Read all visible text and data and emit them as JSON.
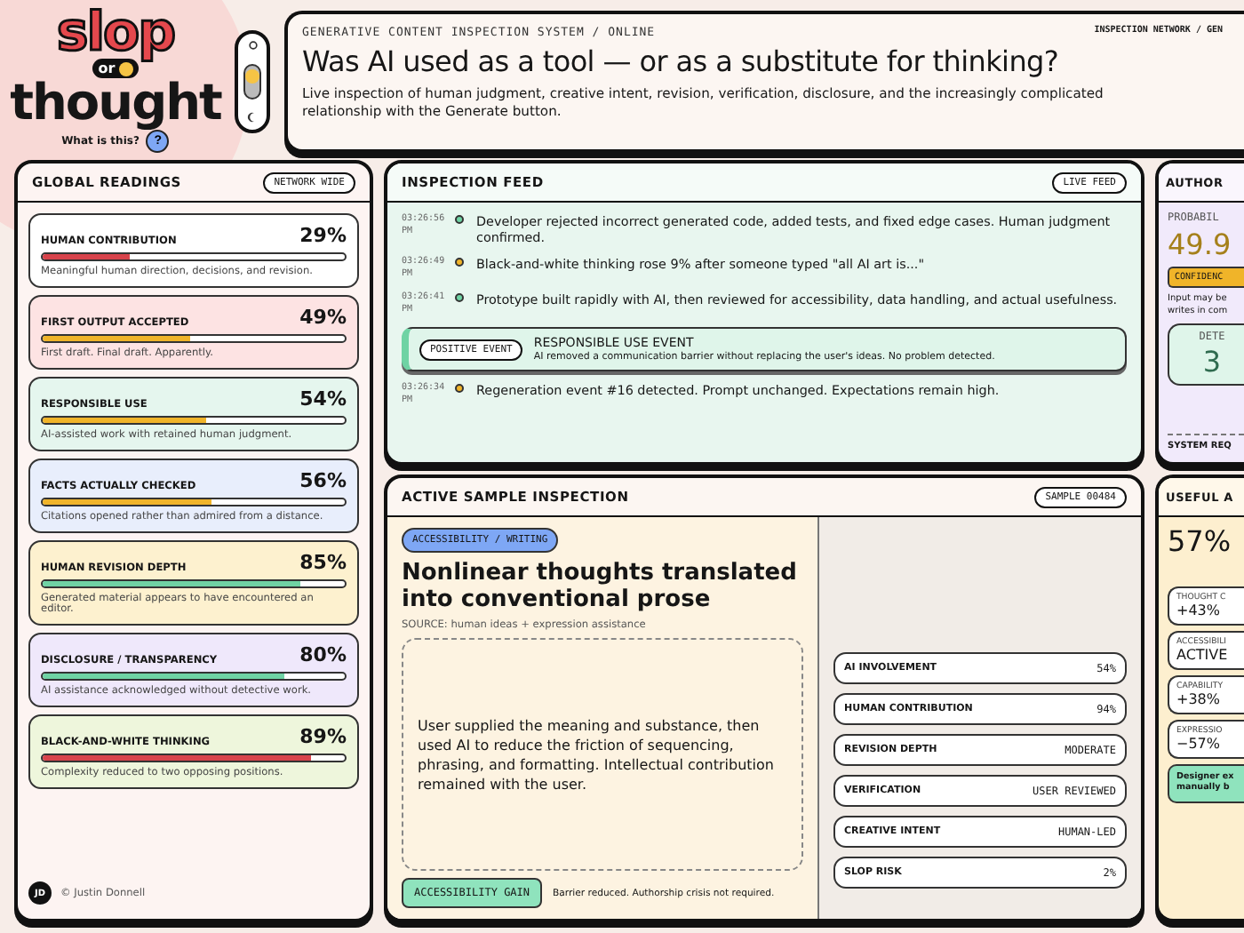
{
  "logo": {
    "word_top": "slop",
    "word_mid": "or",
    "word_bottom": "thought",
    "help_label": "What is this?",
    "help_button": "?"
  },
  "header": {
    "kicker": "GENERATIVE CONTENT INSPECTION SYSTEM / ONLINE",
    "network": "INSPECTION NETWORK / GEN",
    "title": "Was AI used as a tool — or as a substitute for thinking?",
    "subtitle": "Live inspection of human judgment, creative intent, revision, verification, disclosure, and the increasingly complicated relationship with the Generate button."
  },
  "global_readings": {
    "title": "GLOBAL READINGS",
    "badge": "NETWORK WIDE",
    "metrics": [
      {
        "name": "HUMAN CONTRIBUTION",
        "value": "29%",
        "level": 0.29,
        "color": "#d8434b",
        "description": "Meaningful human direction, decisions, and revision."
      },
      {
        "name": "FIRST OUTPUT ACCEPTED",
        "value": "49%",
        "level": 0.49,
        "color": "#f0b429",
        "description": "First draft. Final draft. Apparently."
      },
      {
        "name": "RESPONSIBLE USE",
        "value": "54%",
        "level": 0.54,
        "color": "#f0b429",
        "description": "AI-assisted work with retained human judgment."
      },
      {
        "name": "FACTS ACTUALLY CHECKED",
        "value": "56%",
        "level": 0.56,
        "color": "#f0b429",
        "description": "Citations opened rather than admired from a distance."
      },
      {
        "name": "HUMAN REVISION DEPTH",
        "value": "85%",
        "level": 0.85,
        "color": "#6fd3a4",
        "description": "Generated material appears to have encountered an editor."
      },
      {
        "name": "DISCLOSURE / TRANSPARENCY",
        "value": "80%",
        "level": 0.8,
        "color": "#6fd3a4",
        "description": "AI assistance acknowledged without detective work."
      },
      {
        "name": "BLACK-AND-WHITE THINKING",
        "value": "89%",
        "level": 0.89,
        "color": "#d8434b",
        "description": "Complexity reduced to two opposing positions."
      }
    ],
    "footer": {
      "initials": "JD",
      "credit": "© Justin Donnell"
    }
  },
  "feed": {
    "title": "INSPECTION FEED",
    "badge": "LIVE FEED",
    "items": [
      {
        "kind": "log",
        "time": "03:26:56 PM",
        "color": "#6fd3a4",
        "text": "Developer rejected incorrect generated code, added tests, and fixed edge cases. Human judgment confirmed."
      },
      {
        "kind": "log",
        "time": "03:26:49 PM",
        "color": "#f0b429",
        "text": "Black-and-white thinking rose 9% after someone typed \"all AI art is...\""
      },
      {
        "kind": "log",
        "time": "03:26:41 PM",
        "color": "#6fd3a4",
        "text": "Prototype built rapidly with AI, then reviewed for accessibility, data handling, and actual usefulness."
      },
      {
        "kind": "event",
        "badge": "POSITIVE EVENT",
        "title": "RESPONSIBLE USE EVENT",
        "text": "AI removed a communication barrier without replacing the user's ideas. No problem detected."
      },
      {
        "kind": "log",
        "time": "03:26:34 PM",
        "color": "#f0b429",
        "text": "Regeneration event #16 detected. Prompt unchanged. Expectations remain high."
      }
    ]
  },
  "sample": {
    "title": "ACTIVE SAMPLE INSPECTION",
    "badge": "SAMPLE 00484",
    "tag": "ACCESSIBILITY / WRITING",
    "heading": "Nonlinear thoughts translated into conventional prose",
    "source": "SOURCE: human ideas + expression assistance",
    "body": "User supplied the meaning and substance, then used AI to reduce the friction of sequencing, phrasing, and formatting. Intellectual contribution remained with the user.",
    "verdict": "ACCESSIBILITY GAIN",
    "verdict_note": "Barrier reduced. Authorship crisis not required.",
    "stats": [
      {
        "label": "AI INVOLVEMENT",
        "value": "54%"
      },
      {
        "label": "HUMAN CONTRIBUTION",
        "value": "94%"
      },
      {
        "label": "REVISION DEPTH",
        "value": "MODERATE"
      },
      {
        "label": "VERIFICATION",
        "value": "USER REVIEWED"
      },
      {
        "label": "CREATIVE INTENT",
        "value": "HUMAN-LED"
      },
      {
        "label": "SLOP RISK",
        "value": "2%"
      }
    ]
  },
  "authorship": {
    "title": "AUTHOR",
    "kicker": "PROBABIL",
    "value": "49.9",
    "badge": "CONFIDENC",
    "note_lines": [
      "Input may be",
      "writes in com"
    ],
    "detector_label": "DETE",
    "detector_value": "3",
    "footer": "SYSTEM REQ"
  },
  "useful": {
    "title": "USEFUL A",
    "value": "57%",
    "cards": [
      {
        "label": "THOUGHT C",
        "value": "+43%"
      },
      {
        "label": "ACCESSIBILI",
        "value": "ACTIVE"
      },
      {
        "label": "CAPABILITY",
        "value": "+38%"
      },
      {
        "label": "EXPRESSIO",
        "value": "−57%"
      }
    ],
    "note_lines": [
      "Designer ex",
      "manually b"
    ]
  }
}
